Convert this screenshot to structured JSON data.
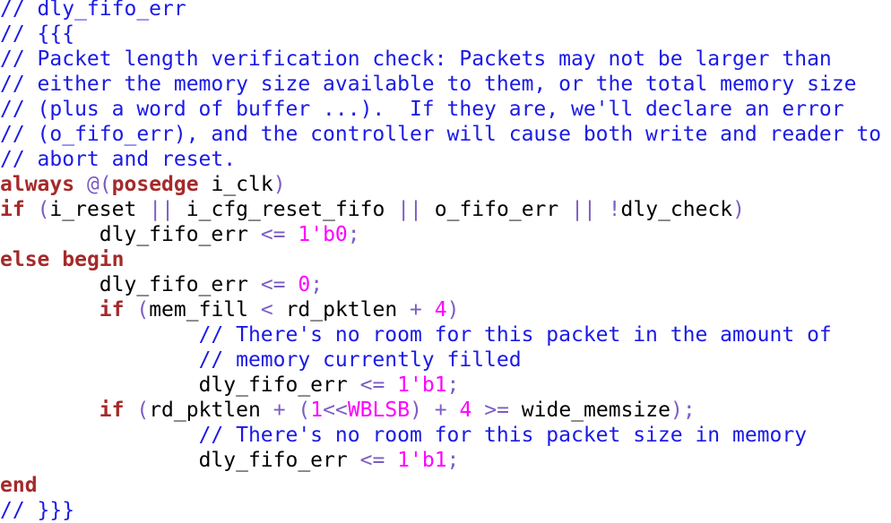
{
  "editor": {
    "lines": [
      [
        {
          "t": "// dly_fifo_err",
          "k": "comment"
        }
      ],
      [
        {
          "t": "// {{{",
          "k": "comment"
        }
      ],
      [
        {
          "t": "// Packet length verification check: Packets may not be larger than",
          "k": "comment"
        }
      ],
      [
        {
          "t": "// either the memory size available to them, or the total memory size",
          "k": "comment"
        }
      ],
      [
        {
          "t": "// (plus a word of buffer ...).  If they are, we'll declare an error",
          "k": "comment"
        }
      ],
      [
        {
          "t": "// (o_fifo_err), and the controller will cause both write and reader to",
          "k": "comment"
        }
      ],
      [
        {
          "t": "// abort and reset.",
          "k": "comment"
        }
      ],
      [
        {
          "t": "always",
          "k": "keyword"
        },
        {
          "t": " ",
          "k": "ws"
        },
        {
          "t": "@(",
          "k": "operator"
        },
        {
          "t": "posedge",
          "k": "keyword"
        },
        {
          "t": " ",
          "k": "ws"
        },
        {
          "t": "i_clk",
          "k": "ident"
        },
        {
          "t": ")",
          "k": "operator"
        }
      ],
      [
        {
          "t": "if",
          "k": "keyword"
        },
        {
          "t": " ",
          "k": "ws"
        },
        {
          "t": "(",
          "k": "operator"
        },
        {
          "t": "i_reset",
          "k": "ident"
        },
        {
          "t": " ",
          "k": "ws"
        },
        {
          "t": "||",
          "k": "operator"
        },
        {
          "t": " ",
          "k": "ws"
        },
        {
          "t": "i_cfg_reset_fifo",
          "k": "ident"
        },
        {
          "t": " ",
          "k": "ws"
        },
        {
          "t": "||",
          "k": "operator"
        },
        {
          "t": " ",
          "k": "ws"
        },
        {
          "t": "o_fifo_err",
          "k": "ident"
        },
        {
          "t": " ",
          "k": "ws"
        },
        {
          "t": "||",
          "k": "operator"
        },
        {
          "t": " ",
          "k": "ws"
        },
        {
          "t": "!",
          "k": "operator"
        },
        {
          "t": "dly_check",
          "k": "ident"
        },
        {
          "t": ")",
          "k": "operator"
        }
      ],
      [
        {
          "t": "        ",
          "k": "ws"
        },
        {
          "t": "dly_fifo_err",
          "k": "ident"
        },
        {
          "t": " ",
          "k": "ws"
        },
        {
          "t": "<=",
          "k": "operator"
        },
        {
          "t": " ",
          "k": "ws"
        },
        {
          "t": "1'b0",
          "k": "number"
        },
        {
          "t": ";",
          "k": "operator"
        }
      ],
      [
        {
          "t": "else",
          "k": "keyword"
        },
        {
          "t": " ",
          "k": "ws"
        },
        {
          "t": "begin",
          "k": "keyword"
        }
      ],
      [
        {
          "t": "        ",
          "k": "ws"
        },
        {
          "t": "dly_fifo_err",
          "k": "ident"
        },
        {
          "t": " ",
          "k": "ws"
        },
        {
          "t": "<=",
          "k": "operator"
        },
        {
          "t": " ",
          "k": "ws"
        },
        {
          "t": "0",
          "k": "number"
        },
        {
          "t": ";",
          "k": "operator"
        }
      ],
      [
        {
          "t": "        ",
          "k": "ws"
        },
        {
          "t": "if",
          "k": "keyword"
        },
        {
          "t": " ",
          "k": "ws"
        },
        {
          "t": "(",
          "k": "operator"
        },
        {
          "t": "mem_fill",
          "k": "ident"
        },
        {
          "t": " ",
          "k": "ws"
        },
        {
          "t": "<",
          "k": "operator"
        },
        {
          "t": " ",
          "k": "ws"
        },
        {
          "t": "rd_pktlen",
          "k": "ident"
        },
        {
          "t": " ",
          "k": "ws"
        },
        {
          "t": "+",
          "k": "operator"
        },
        {
          "t": " ",
          "k": "ws"
        },
        {
          "t": "4",
          "k": "number"
        },
        {
          "t": ")",
          "k": "operator"
        }
      ],
      [
        {
          "t": "                ",
          "k": "ws"
        },
        {
          "t": "// There's no room for this packet in the amount of",
          "k": "comment"
        }
      ],
      [
        {
          "t": "                ",
          "k": "ws"
        },
        {
          "t": "// memory currently filled",
          "k": "comment"
        }
      ],
      [
        {
          "t": "                ",
          "k": "ws"
        },
        {
          "t": "dly_fifo_err",
          "k": "ident"
        },
        {
          "t": " ",
          "k": "ws"
        },
        {
          "t": "<=",
          "k": "operator"
        },
        {
          "t": " ",
          "k": "ws"
        },
        {
          "t": "1'b1",
          "k": "number"
        },
        {
          "t": ";",
          "k": "operator"
        }
      ],
      [
        {
          "t": "        ",
          "k": "ws"
        },
        {
          "t": "if",
          "k": "keyword"
        },
        {
          "t": " ",
          "k": "ws"
        },
        {
          "t": "(",
          "k": "operator"
        },
        {
          "t": "rd_pktlen",
          "k": "ident"
        },
        {
          "t": " ",
          "k": "ws"
        },
        {
          "t": "+",
          "k": "operator"
        },
        {
          "t": " ",
          "k": "ws"
        },
        {
          "t": "(",
          "k": "operator"
        },
        {
          "t": "1",
          "k": "number"
        },
        {
          "t": "<<",
          "k": "operator"
        },
        {
          "t": "WBLSB",
          "k": "number"
        },
        {
          "t": ")",
          "k": "operator"
        },
        {
          "t": " ",
          "k": "ws"
        },
        {
          "t": "+",
          "k": "operator"
        },
        {
          "t": " ",
          "k": "ws"
        },
        {
          "t": "4",
          "k": "number"
        },
        {
          "t": " ",
          "k": "ws"
        },
        {
          "t": ">=",
          "k": "operator"
        },
        {
          "t": " ",
          "k": "ws"
        },
        {
          "t": "wide_memsize",
          "k": "ident"
        },
        {
          "t": ");",
          "k": "operator"
        }
      ],
      [
        {
          "t": "                ",
          "k": "ws"
        },
        {
          "t": "// There's no room for this packet size in memory",
          "k": "comment"
        }
      ],
      [
        {
          "t": "                ",
          "k": "ws"
        },
        {
          "t": "dly_fifo_err",
          "k": "ident"
        },
        {
          "t": " ",
          "k": "ws"
        },
        {
          "t": "<=",
          "k": "operator"
        },
        {
          "t": " ",
          "k": "ws"
        },
        {
          "t": "1'b1",
          "k": "number"
        },
        {
          "t": ";",
          "k": "operator"
        }
      ],
      [
        {
          "t": "end",
          "k": "keyword"
        }
      ],
      [
        {
          "t": "// }}}",
          "k": "comment"
        }
      ]
    ]
  },
  "colors": {
    "comment": "#1a1ae6",
    "keyword": "#a52a2a",
    "operator": "#7b5cc4",
    "number": "#ff00ff",
    "identifier": "#000000",
    "background": "#ffffff"
  }
}
